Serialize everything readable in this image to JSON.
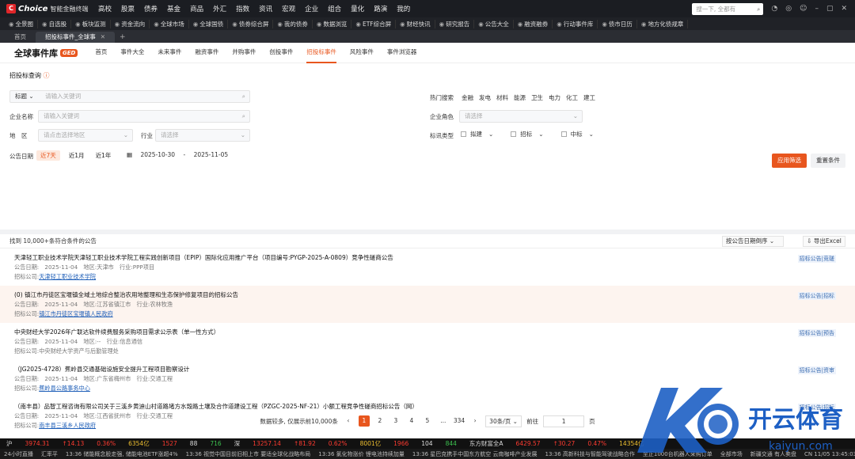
{
  "app": {
    "brand": "Choice",
    "brand_sub": "智能金融终端",
    "logo_mark": "C"
  },
  "topnav": [
    "高校",
    "股票",
    "债券",
    "基金",
    "商品",
    "外汇",
    "指数",
    "资讯",
    "宏观",
    "企业",
    "组合",
    "量化",
    "路演",
    "我的"
  ],
  "search": {
    "placeholder": "搜一下, 全都有"
  },
  "quickbar": [
    "全景图",
    "自选股",
    "板块监测",
    "资金流向",
    "全球市场",
    "全球国债",
    "债券综合屏",
    "我的债券",
    "数据浏览",
    "ETF综合屏",
    "财经快讯",
    "研究报告",
    "公告大全",
    "融资融券",
    "行动事件库",
    "债市日历",
    "地方化债规章"
  ],
  "tabs": [
    {
      "label": "首页"
    },
    {
      "label": "招投标事件_全球事"
    }
  ],
  "module": {
    "title": "全球事件库",
    "badge": "GED",
    "nav": [
      "首页",
      "事件大全",
      "未来事件",
      "融资事件",
      "并购事件",
      "创投事件",
      "招投标事件",
      "风险事件",
      "事件浏览器"
    ],
    "active_nav": "招投标事件"
  },
  "query": {
    "title": "招投标查询",
    "title_field": {
      "label": "标题",
      "placeholder": "请输入关键词"
    },
    "company_field": {
      "label": "企业名称",
      "placeholder": "请输入关键词"
    },
    "region_field": {
      "label": "地　区",
      "placeholder": "请点击选择地区"
    },
    "industry_field": {
      "label": "行业",
      "placeholder": "请选择"
    },
    "hot_label": "热门搜索",
    "hot": [
      "金融",
      "发电",
      "材料",
      "能源",
      "卫生",
      "电力",
      "化工",
      "建工"
    ],
    "role_field": {
      "label": "企业角色",
      "placeholder": "请选择"
    },
    "type_label": "标讯类型",
    "types": [
      "拟建",
      "招标",
      "中标"
    ],
    "date_label": "公告日期",
    "date_options": [
      "近7天",
      "近1月",
      "近1年"
    ],
    "date_from": "2025-10-30",
    "date_sep": "-",
    "date_to": "2025-11-05",
    "apply_button": "应用筛选",
    "reset_button": "重置条件"
  },
  "results": {
    "count_text": "找到 10,000+条符合条件的公告",
    "sort_label": "按公告日期倒序",
    "export_label": "导出Excel",
    "date_label": "公告日期:",
    "region_label": "地区:",
    "industry_label": "行业:",
    "tenderer_label": "招标公司:",
    "items": [
      {
        "title": "天津轻工职业技术学院天津轻工职业技术学院工程实践创新项目（EPIP）国际化应用推广平台（项目编号:PYGP-2025-A-0809）竞争性磋商公告",
        "date": "2025-11-04",
        "region": "天津市",
        "industry": "PPP项目",
        "company": "天津轻工职业技术学院",
        "tag": "招标公告|竞磋"
      },
      {
        "title": "(0) 镇江市丹徒区宝堰镇全域土地综合整治农用地整理和生态保护修复项目的招标公告",
        "date": "2025-11-04",
        "region": "江苏省镇江市",
        "industry": "农林牧渔",
        "company": "镇江市丹徒区宝堰镇人民政府",
        "tag": "招标公告|招标"
      },
      {
        "title": "中央财经大学2026年广联达软件续费服务采购项目需求公示表（单一性方式）",
        "date": "2025-11-04",
        "region": "--",
        "industry": "信息通信",
        "company": "中央财经大学资产与后勤管理处",
        "tag": "招标公告|预告"
      },
      {
        "title": "（JG2025-4728）蕉岭县交通基础设施安全提升工程项目勘察设计",
        "date": "2025-11-04",
        "region": "广东省梅州市",
        "industry": "交通工程",
        "company": "蕉岭县公路事务中心",
        "tag": "招标公告|资审"
      },
      {
        "title": "（南丰县）品智工程咨询有限公司关于三溪乡黄迪山村道路堵方水毁路土壤及合作道建设工程（PZGC-2025-NF-21）小额工程竞争性磋商招标公告（网）",
        "date": "2025-11-04",
        "region": "江西省抚州市",
        "industry": "交通工程",
        "company": "南丰县三溪乡人民政府",
        "tag": "招标公告|招标"
      }
    ]
  },
  "pagination": {
    "note": "数据较多, 仅展示前10,000条",
    "pages": [
      "1",
      "2",
      "3",
      "4",
      "5",
      "...",
      "334"
    ],
    "current": "1",
    "page_size": "30条/页",
    "goto_label": "前往",
    "goto_value": "1",
    "page_suffix": "页"
  },
  "ticker": [
    {
      "t": "沪",
      "c": ""
    },
    {
      "t": "3974.31",
      "c": "up"
    },
    {
      "t": "↑14.13",
      "c": "up"
    },
    {
      "t": "0.36%",
      "c": "up"
    },
    {
      "t": "6354亿",
      "c": "yel"
    },
    {
      "t": "1527",
      "c": "up"
    },
    {
      "t": "88",
      "c": ""
    },
    {
      "t": "716",
      "c": "grn"
    },
    {
      "t": "深",
      "c": ""
    },
    {
      "t": "13257.14",
      "c": "up"
    },
    {
      "t": "↑81.92",
      "c": "up"
    },
    {
      "t": "0.62%",
      "c": "up"
    },
    {
      "t": "8001亿",
      "c": "yel"
    },
    {
      "t": "1966",
      "c": "up"
    },
    {
      "t": "104",
      "c": ""
    },
    {
      "t": "844",
      "c": "grn"
    },
    {
      "t": "东方财富全A",
      "c": ""
    },
    {
      "t": "6429.57",
      "c": "up"
    },
    {
      "t": "↑30.27",
      "c": "up"
    },
    {
      "t": "0.47%",
      "c": "up"
    },
    {
      "t": "14354亿",
      "c": "yel"
    }
  ],
  "newsbar": [
    "24小时直播",
    "汇率平",
    "13:36 储能概念股走强, 储能电池ETF涨超4%",
    "13:36 视觉中国目前旧相上市 要适全球化战略布局",
    "13:36 氯化物涨价 锂电池持续加量",
    "13:36 星巴克携手中国东方航空 云南咖啡产业发展",
    "13:36 高新科技与智能驾驶战略合作",
    "至正1000台机器人采购订单",
    "全部市场",
    "新疆交通 有人卖盘",
    "CN 11/05 13:45:03"
  ],
  "watermark": {
    "name": "开云体育",
    "domain": "kaiyun.com"
  }
}
